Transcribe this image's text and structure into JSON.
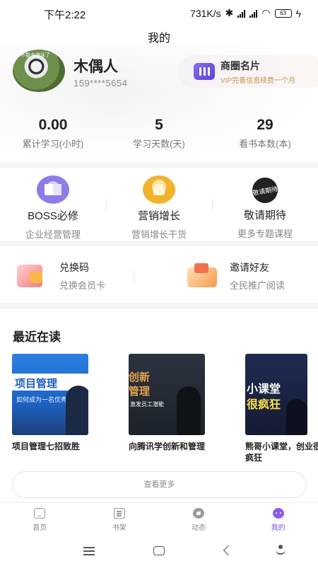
{
  "status_bar": {
    "time": "下午2:22",
    "network_speed": "731K/s",
    "battery": "63"
  },
  "header": {
    "title": "我的"
  },
  "profile": {
    "avatar_caption": "你不能去游泳了",
    "name": "木偶人",
    "phone": "159****5654"
  },
  "business_card": {
    "title": "商圈名片",
    "subtitle": "VIP完善信息续费一个月"
  },
  "stats": [
    {
      "value": "0.00",
      "label": "累计学习(小时)"
    },
    {
      "value": "5",
      "label": "学习天数(天)"
    },
    {
      "value": "29",
      "label": "看书本数(本)"
    }
  ],
  "features": [
    {
      "title": "BOSS必修",
      "subtitle": "企业经营管理",
      "icon": "book-icon"
    },
    {
      "title": "营销增长",
      "subtitle": "营销增长干货",
      "icon": "trophy-icon"
    },
    {
      "title": "敬请期待",
      "subtitle": "更多专题课程",
      "icon": "coming-soon-icon",
      "icon_text": "敬请期待"
    }
  ],
  "tools": [
    {
      "title": "兑换码",
      "subtitle": "兑换会员卡",
      "icon": "redeem-code-icon"
    },
    {
      "title": "邀请好友",
      "subtitle": "全民推广阅读",
      "icon": "invite-friends-icon"
    }
  ],
  "recent": {
    "title": "最近在读",
    "books": [
      {
        "title": "项目管理七招致胜",
        "cover_line1": "项目管理",
        "cover_line2": "如何成为一名优秀的"
      },
      {
        "title": "向腾讯学创新和管理",
        "cover_line1": "创新",
        "cover_line2": "管理",
        "cover_line3": "激发员工潜能"
      },
      {
        "title": "熊哥小课堂，创业很疯狂",
        "cover_line1": "小课堂",
        "cover_line2": "很疯狂"
      }
    ],
    "more_label": "查看更多"
  },
  "tabbar": {
    "items": [
      {
        "label": "首页",
        "icon": "home-icon"
      },
      {
        "label": "书架",
        "icon": "bookshelf-icon"
      },
      {
        "label": "动态",
        "icon": "feed-icon"
      },
      {
        "label": "我的",
        "icon": "profile-icon",
        "active": true
      }
    ],
    "active_color": "#7b55e8"
  }
}
